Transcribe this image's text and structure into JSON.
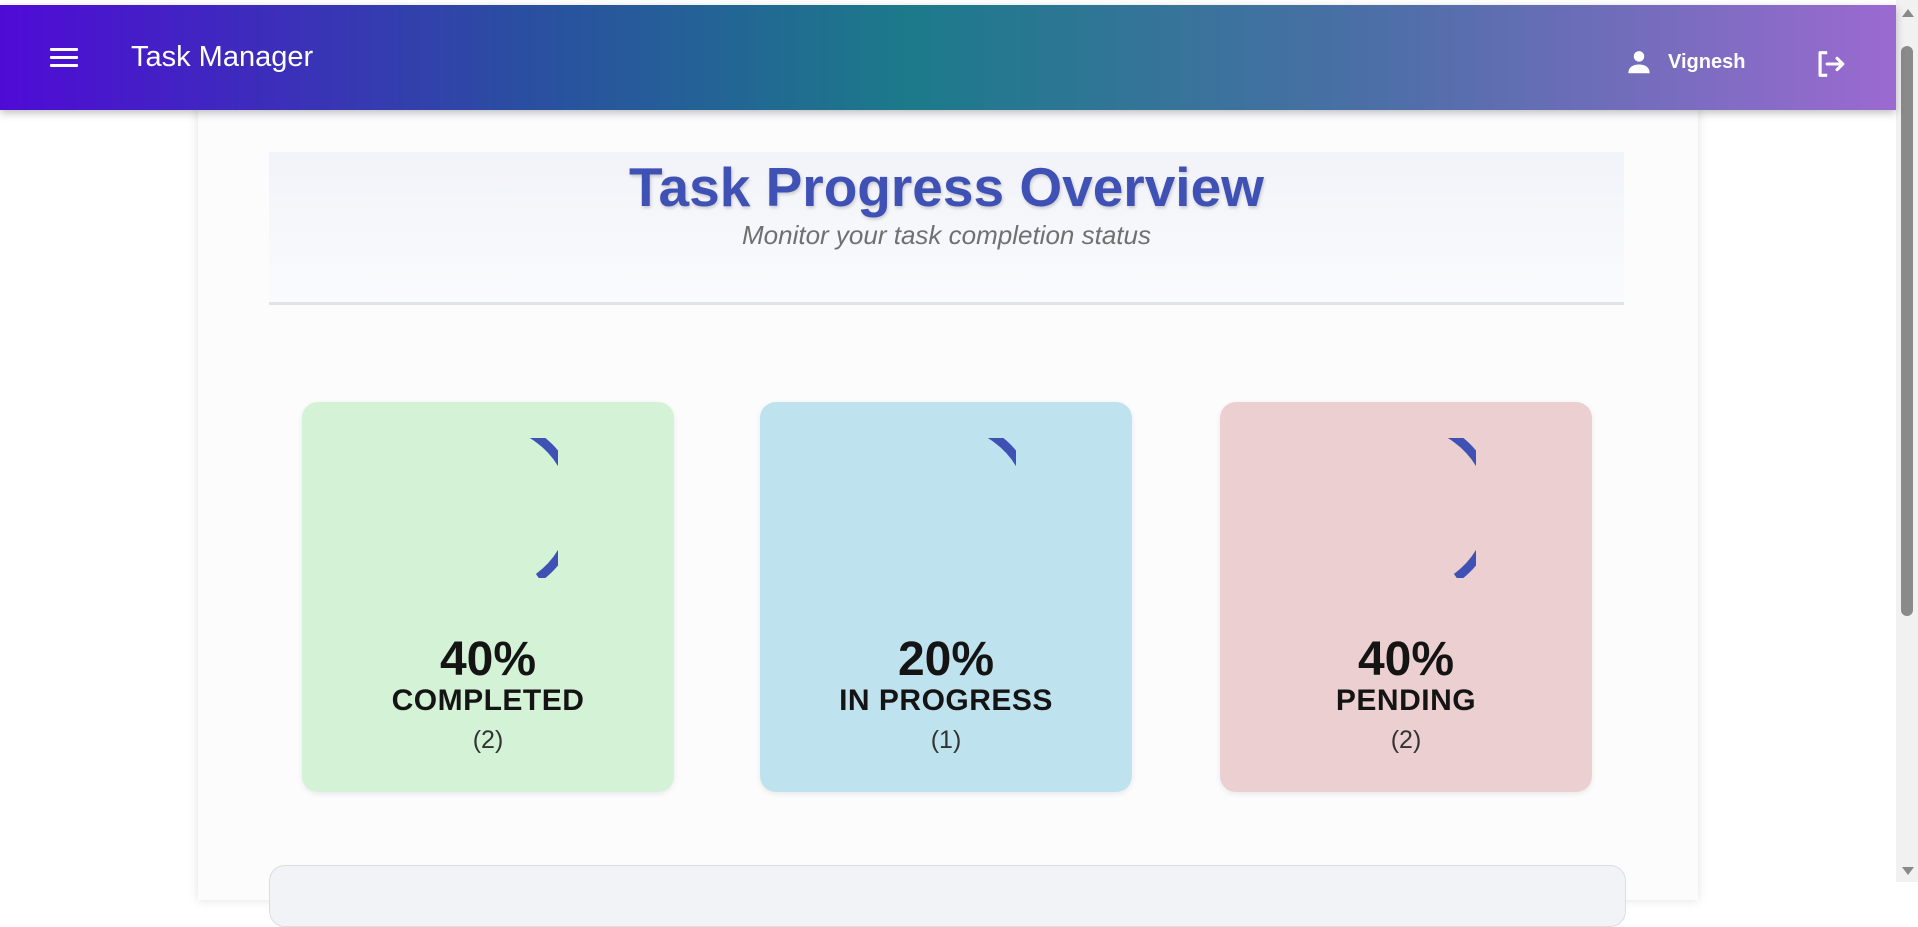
{
  "app": {
    "title": "Task Manager",
    "user_name": "Vignesh"
  },
  "icons": {
    "menu": "menu-icon",
    "user": "person-icon",
    "logout": "logout-icon"
  },
  "overview": {
    "title": "Task Progress Overview",
    "subtitle": "Monitor your task completion status"
  },
  "stats": [
    {
      "percent_label": "40%",
      "percent": 40,
      "label": "COMPLETED",
      "count_label": "(2)",
      "bg": "#d4f2d6"
    },
    {
      "percent_label": "20%",
      "percent": 20,
      "label": "IN PROGRESS",
      "count_label": "(1)",
      "bg": "#bfe3ee"
    },
    {
      "percent_label": "40%",
      "percent": 40,
      "label": "PENDING",
      "count_label": "(2)",
      "bg": "#ecd0d1"
    }
  ],
  "colors": {
    "accent": "#3f51b5",
    "completed_bg": "#d4f2d6",
    "in_progress_bg": "#bfe3ee",
    "pending_bg": "#ecd0d1"
  }
}
